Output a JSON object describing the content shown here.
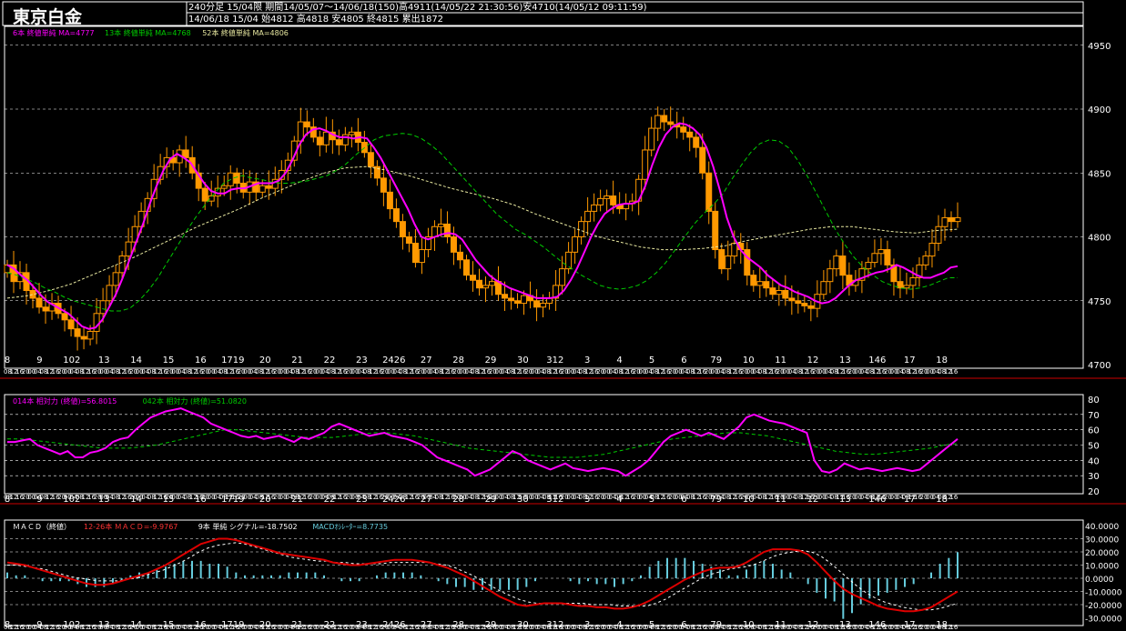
{
  "header": {
    "title": "東京白金",
    "line1": "240分足 15/04限 期間14/05/07〜14/06/18(150)高4911(14/05/22 21:30:56)安4710(14/05/12 09:11:59)",
    "line2": "14/06/18 15/04 始4812 高4818 安4805 終4815 累出1872"
  },
  "colors": {
    "background": "#000000",
    "candle": "#ff9900",
    "ma6": "#ff00ff",
    "ma13": "#00cc00",
    "ma52": "#e8e8a0",
    "grid": "#ffffff",
    "rsi14": "#ff00ff",
    "rsi42": "#00cc00",
    "macd": "#dd0000",
    "signal": "#ffffff",
    "osc": "#66ccdd",
    "separator": "#cc0000"
  },
  "price_panel": {
    "legend": [
      {
        "text": "6本 終値単純 MA=4777",
        "color": "#ff00ff"
      },
      {
        "text": "13本 終値単純 MA=4768",
        "color": "#00cc00"
      },
      {
        "text": "52本 終値単純 MA=4806",
        "color": "#e8e8a0"
      }
    ],
    "y_ticks": [
      "4950",
      "4900",
      "4850",
      "4800",
      "4750",
      "4700"
    ]
  },
  "rsi_panel": {
    "legend": [
      {
        "text": "014本 相対力 (終値)=56.8015",
        "color": "#ff00ff"
      },
      {
        "text": "042本 相対力 (終値)=51.0820",
        "color": "#00cc00"
      }
    ],
    "y_ticks": [
      "80",
      "70",
      "60",
      "50",
      "40",
      "30",
      "20"
    ]
  },
  "macd_panel": {
    "legend": [
      {
        "text": "ＭＡＣＤ（終値）",
        "color": "#ffffff"
      },
      {
        "text": "12-26本 ＭＡＣＤ=-9.9767",
        "color": "#ff3333"
      },
      {
        "text": "9本 単純 シグナル=-18.7502",
        "color": "#ffffff"
      },
      {
        "text": "MACDｵｼﾚｰﾀｰ=8.7735",
        "color": "#66ccdd"
      }
    ],
    "y_ticks": [
      "40.0000",
      "30.0000",
      "20.0000",
      "10.0000",
      "0.0000",
      "-10.0000",
      "-20.0000",
      "-30.0000"
    ]
  },
  "x_axis": {
    "date_labels": [
      "8",
      "9",
      "102",
      "13",
      "14",
      "15",
      "16",
      "1719",
      "20",
      "21",
      "22",
      "23",
      "2426",
      "27",
      "28",
      "29",
      "30",
      "312",
      "3",
      "4",
      "5",
      "6",
      "79",
      "10",
      "11",
      "12",
      "13",
      "146",
      "17",
      "18"
    ],
    "hour_labels": [
      "08",
      "12",
      "16",
      "20",
      "00",
      "04",
      "08",
      "12",
      "16",
      "20",
      "00",
      "04",
      "08",
      "12",
      "16",
      "20",
      "00",
      "04",
      "08",
      "12",
      "16",
      "20",
      "00",
      "04",
      "08",
      "12",
      "16",
      "20",
      "00",
      "04",
      "08",
      "12",
      "16",
      "20",
      "00",
      "04",
      "08",
      "12",
      "16",
      "20",
      "00",
      "04",
      "08",
      "12",
      "16",
      "20",
      "00",
      "04",
      "08",
      "12",
      "16",
      "20",
      "00",
      "04",
      "08",
      "12",
      "16",
      "20",
      "00",
      "04",
      "08",
      "12",
      "16",
      "20",
      "00",
      "04",
      "08",
      "12",
      "16",
      "20",
      "00",
      "04",
      "08",
      "12",
      "16",
      "20",
      "00",
      "04",
      "08",
      "12",
      "16",
      "20",
      "00",
      "04",
      "08",
      "12",
      "16",
      "20",
      "00",
      "04",
      "08",
      "12",
      "16",
      "20",
      "00",
      "04",
      "08",
      "12",
      "16",
      "20",
      "00",
      "04",
      "08",
      "12",
      "16",
      "20",
      "00",
      "04",
      "08",
      "12",
      "16",
      "20",
      "00",
      "04",
      "08",
      "12",
      "16",
      "20",
      "00",
      "04",
      "08",
      "12",
      "16",
      "20",
      "00",
      "04",
      "08",
      "12",
      "16",
      "20",
      "00",
      "04",
      "08",
      "12",
      "16",
      "20",
      "00",
      "04",
      "08",
      "12",
      "16",
      "20",
      "00",
      "04",
      "08",
      "12",
      "16",
      "20",
      "00",
      "04",
      "08",
      "12",
      "16",
      "20",
      "00",
      "04",
      "08",
      "12",
      "16"
    ]
  },
  "chart_data": [
    {
      "type": "candlestick",
      "name": "price",
      "ylim": [
        4700,
        4960
      ],
      "closes": [
        4778,
        4765,
        4772,
        4758,
        4752,
        4745,
        4742,
        4748,
        4740,
        4735,
        4728,
        4722,
        4720,
        4726,
        4740,
        4750,
        4762,
        4772,
        4785,
        4796,
        4808,
        4820,
        4830,
        4845,
        4855,
        4862,
        4858,
        4868,
        4862,
        4850,
        4838,
        4828,
        4832,
        4838,
        4840,
        4850,
        4842,
        4835,
        4843,
        4835,
        4840,
        4838,
        4845,
        4852,
        4860,
        4875,
        4890,
        4886,
        4878,
        4872,
        4882,
        4876,
        4872,
        4880,
        4882,
        4874,
        4866,
        4855,
        4846,
        4835,
        4822,
        4812,
        4800,
        4795,
        4780,
        4790,
        4800,
        4808,
        4810,
        4800,
        4788,
        4782,
        4770,
        4766,
        4760,
        4762,
        4765,
        4755,
        4752,
        4750,
        4748,
        4754,
        4750,
        4745,
        4748,
        4752,
        4762,
        4775,
        4788,
        4800,
        4812,
        4820,
        4825,
        4830,
        4832,
        4825,
        4822,
        4826,
        4828,
        4845,
        4868,
        4885,
        4895,
        4890,
        4888,
        4886,
        4882,
        4878,
        4870,
        4850,
        4820,
        4790,
        4775,
        4785,
        4795,
        4790,
        4770,
        4762,
        4765,
        4760,
        4755,
        4758,
        4752,
        4750,
        4748,
        4746,
        4744,
        4755,
        4765,
        4775,
        4785,
        4770,
        4762,
        4766,
        4775,
        4780,
        4787,
        4790,
        4778,
        4765,
        4760,
        4762,
        4768,
        4778,
        4785,
        4795,
        4808,
        4815,
        4812,
        4815
      ],
      "ma6": [
        4778,
        4775,
        4770,
        4766,
        4760,
        4754,
        4749,
        4746,
        4743,
        4740,
        4735,
        4730,
        4728,
        4729,
        4735,
        4745,
        4755,
        4768,
        4782,
        4796,
        4810,
        4826,
        4840,
        4852,
        4861,
        4865,
        4862,
        4858,
        4850,
        4842,
        4836,
        4834,
        4834,
        4837,
        4838,
        4838,
        4840,
        4842,
        4842,
        4842,
        4844,
        4850,
        4860,
        4872,
        4880,
        4884,
        4885,
        4883,
        4880,
        4878,
        4878,
        4877,
        4878,
        4877,
        4870,
        4862,
        4852,
        4842,
        4832,
        4822,
        4810,
        4800,
        4798,
        4800,
        4802,
        4803,
        4802,
        4798,
        4790,
        4782,
        4776,
        4770,
        4766,
        4763,
        4760,
        4758,
        4756,
        4754,
        4752,
        4752,
        4752,
        4753,
        4758,
        4766,
        4776,
        4788,
        4800,
        4810,
        4818,
        4822,
        4825,
        4826,
        4826,
        4828,
        4840,
        4856,
        4870,
        4880,
        4886,
        4889,
        4888,
        4885,
        4880,
        4870,
        4855,
        4836,
        4815,
        4800,
        4790,
        4784,
        4780,
        4776,
        4770,
        4766,
        4762,
        4760,
        4757,
        4755,
        4753,
        4750,
        4748,
        4749,
        4752,
        4757,
        4762,
        4766,
        4768,
        4770,
        4772,
        4773,
        4775,
        4778,
        4776,
        4773,
        4770,
        4768,
        4768,
        4770,
        4772,
        4776,
        4777
      ],
      "ma13": [
        4772,
        4770,
        4767,
        4764,
        4760,
        4757,
        4753,
        4750,
        4748,
        4746,
        4744,
        4742,
        4742,
        4744,
        4750,
        4758,
        4768,
        4780,
        4792,
        4804,
        4815,
        4825,
        4834,
        4842,
        4846,
        4848,
        4846,
        4845,
        4843,
        4842,
        4842,
        4843,
        4844,
        4846,
        4848,
        4852,
        4857,
        4864,
        4870,
        4876,
        4879,
        4880,
        4881,
        4880,
        4877,
        4872,
        4866,
        4858,
        4850,
        4842,
        4834,
        4826,
        4818,
        4812,
        4806,
        4802,
        4797,
        4792,
        4786,
        4780,
        4775,
        4770,
        4766,
        4762,
        4760,
        4759,
        4760,
        4762,
        4766,
        4772,
        4780,
        4790,
        4800,
        4810,
        4818,
        4825,
        4833,
        4845,
        4856,
        4866,
        4873,
        4876,
        4875,
        4870,
        4860,
        4848,
        4834,
        4820,
        4806,
        4794,
        4784,
        4776,
        4770,
        4765,
        4762,
        4760,
        4759,
        4760,
        4762,
        4765,
        4768,
        4768
      ],
      "ma52": [
        4752,
        4754,
        4758,
        4763,
        4770,
        4777,
        4784,
        4792,
        4800,
        4808,
        4815,
        4822,
        4830,
        4837,
        4844,
        4850,
        4854,
        4855,
        4852,
        4848,
        4843,
        4838,
        4834,
        4830,
        4825,
        4818,
        4812,
        4806,
        4800,
        4796,
        4792,
        4790,
        4790,
        4791,
        4793,
        4797,
        4800,
        4803,
        4806,
        4808,
        4808,
        4806,
        4804,
        4803,
        4805,
        4806
      ]
    },
    {
      "type": "line",
      "name": "rsi",
      "ylim": [
        20,
        80
      ],
      "series14": [
        52,
        52,
        53,
        54,
        50,
        48,
        46,
        44,
        46,
        42,
        42,
        45,
        46,
        48,
        52,
        54,
        55,
        60,
        64,
        68,
        70,
        72,
        73,
        74,
        72,
        70,
        68,
        64,
        62,
        60,
        58,
        56,
        55,
        56,
        54,
        55,
        56,
        54,
        52,
        55,
        54,
        56,
        58,
        62,
        64,
        62,
        60,
        58,
        56,
        57,
        58,
        56,
        55,
        54,
        52,
        50,
        46,
        42,
        40,
        38,
        36,
        34,
        30,
        32,
        34,
        38,
        42,
        46,
        44,
        40,
        38,
        36,
        34,
        36,
        38,
        35,
        34,
        33,
        34,
        35,
        34,
        33,
        30,
        33,
        36,
        40,
        46,
        52,
        56,
        58,
        60,
        58,
        56,
        58,
        56,
        54,
        58,
        62,
        68,
        70,
        68,
        66,
        65,
        64,
        62,
        60,
        58,
        40,
        33,
        32,
        34,
        38,
        36,
        34,
        35,
        34,
        33,
        34,
        35,
        34,
        33,
        34,
        38,
        42,
        46,
        50,
        54
      ],
      "series42": [
        54,
        54,
        53,
        52,
        51,
        50,
        49,
        48,
        48,
        48,
        49,
        50,
        52,
        54,
        56,
        58,
        60,
        60,
        59,
        58,
        57,
        56,
        55,
        55,
        55,
        56,
        57,
        58,
        58,
        57,
        56,
        54,
        52,
        50,
        48,
        47,
        46,
        45,
        44,
        43,
        42,
        42,
        42,
        43,
        44,
        46,
        48,
        50,
        52,
        54,
        55,
        56,
        57,
        58,
        58,
        57,
        56,
        54,
        52,
        50,
        48,
        46,
        45,
        44,
        44,
        45,
        46,
        47,
        48,
        50,
        51
      ]
    },
    {
      "type": "macd",
      "name": "macd",
      "ylim": [
        -30,
        40
      ],
      "macd": [
        12,
        11,
        10,
        8,
        6,
        4,
        2,
        0,
        -2,
        -4,
        -5,
        -5,
        -4,
        -2,
        0,
        2,
        4,
        7,
        10,
        14,
        18,
        22,
        26,
        28,
        30,
        30,
        29,
        27,
        25,
        23,
        21,
        19,
        18,
        17,
        16,
        15,
        14,
        12,
        11,
        10,
        10,
        11,
        12,
        13,
        14,
        14,
        14,
        13,
        12,
        10,
        8,
        5,
        2,
        -2,
        -6,
        -10,
        -14,
        -17,
        -20,
        -21,
        -20,
        -19,
        -19,
        -19,
        -20,
        -21,
        -21,
        -22,
        -22,
        -23,
        -23,
        -22,
        -20,
        -17,
        -13,
        -9,
        -5,
        -1,
        2,
        5,
        7,
        8,
        8,
        9,
        12,
        16,
        20,
        22,
        22,
        22,
        21,
        18,
        12,
        5,
        -2,
        -8,
        -12,
        -15,
        -18,
        -21,
        -23,
        -24,
        -25,
        -25,
        -24,
        -22,
        -18,
        -14,
        -10
      ],
      "signal": [
        10,
        10,
        9,
        8,
        7,
        5,
        3,
        1,
        0,
        -1,
        -2,
        -2,
        -2,
        -1,
        0,
        2,
        4,
        6,
        9,
        12,
        16,
        20,
        23,
        25,
        26,
        27,
        26,
        24,
        22,
        20,
        18,
        16,
        15,
        14,
        13,
        13,
        12,
        12,
        11,
        11,
        11,
        11,
        12,
        12,
        12,
        12,
        12,
        11,
        10,
        8,
        5,
        2,
        -2,
        -6,
        -10,
        -13,
        -16,
        -18,
        -19,
        -19,
        -19,
        -19,
        -19,
        -19,
        -20,
        -20,
        -20,
        -21,
        -21,
        -21,
        -21,
        -19,
        -16,
        -12,
        -8,
        -4,
        0,
        3,
        5,
        7,
        8,
        9,
        11,
        14,
        17,
        19,
        20,
        21,
        20,
        17,
        12,
        6,
        0,
        -6,
        -11,
        -15,
        -18,
        -20,
        -22,
        -23,
        -24,
        -24,
        -23,
        -21,
        -19
      ]
    }
  ]
}
